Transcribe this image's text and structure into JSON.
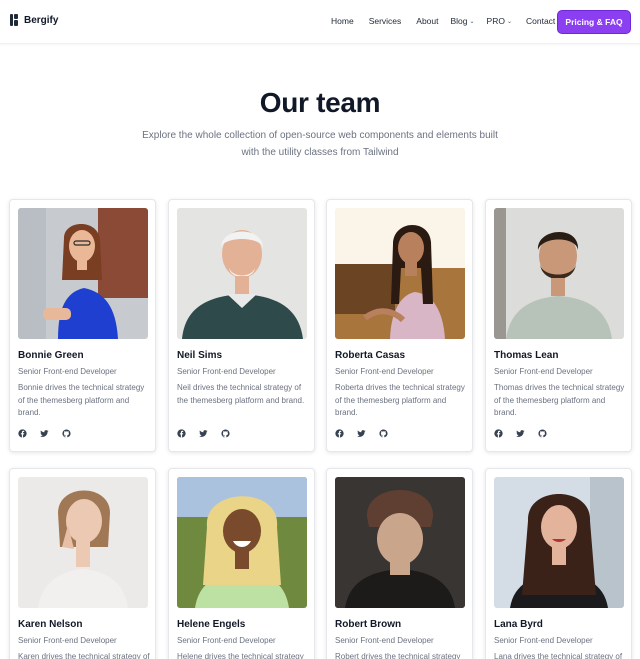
{
  "brand": {
    "name": "Bergify"
  },
  "nav": {
    "items": [
      {
        "label": "Home",
        "dropdown": false
      },
      {
        "label": "Services",
        "dropdown": false
      },
      {
        "label": "About",
        "dropdown": false
      },
      {
        "label": "Blog",
        "dropdown": true
      },
      {
        "label": "PRO",
        "dropdown": true
      },
      {
        "label": "Contact",
        "dropdown": false
      }
    ],
    "cta": "Pricing & FAQ"
  },
  "section": {
    "title": "Our team",
    "subtitle": "Explore the whole collection of open-source web components and elements built with the utility classes from Tailwind"
  },
  "team": [
    {
      "name": "Bonnie Green",
      "role": "Senior Front-end Developer",
      "bio": "Bonnie drives the technical strategy of the themesberg platform and brand."
    },
    {
      "name": "Neil Sims",
      "role": "Senior Front-end Developer",
      "bio": "Neil drives the technical strategy of the themesberg platform and brand."
    },
    {
      "name": "Roberta Casas",
      "role": "Senior Front-end Developer",
      "bio": "Roberta drives the technical strategy of the themesberg platform and brand."
    },
    {
      "name": "Thomas Lean",
      "role": "Senior Front-end Developer",
      "bio": "Thomas drives the technical strategy of the themesberg platform and brand."
    },
    {
      "name": "Karen Nelson",
      "role": "Senior Front-end Developer",
      "bio": "Karen drives the technical strategy of the themesberg platform and brand."
    },
    {
      "name": "Helene Engels",
      "role": "Senior Front-end Developer",
      "bio": "Helene drives the technical strategy of the themesberg platform and brand."
    },
    {
      "name": "Robert Brown",
      "role": "Senior Front-end Developer",
      "bio": "Robert drives the technical strategy of the themesberg platform and brand."
    },
    {
      "name": "Lana Byrd",
      "role": "Senior Front-end Developer",
      "bio": "Lana drives the technical strategy of the themesberg platform and brand."
    }
  ],
  "social_icons": [
    "facebook-icon",
    "twitter-icon",
    "github-icon"
  ],
  "colors": {
    "accent": "#8b3ff0",
    "text": "#111827",
    "muted": "#6b7280"
  }
}
